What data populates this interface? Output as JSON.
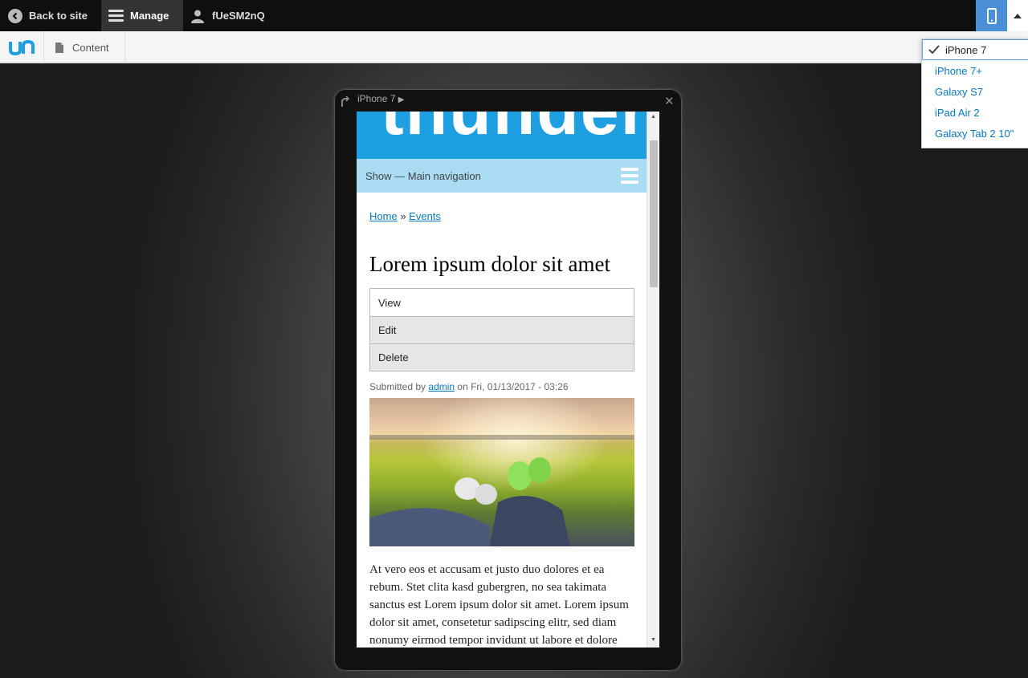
{
  "toolbar": {
    "back_label": "Back to site",
    "manage_label": "Manage",
    "user_label": "fUeSM2nQ"
  },
  "tray": {
    "content_label": "Content"
  },
  "preview": {
    "device_name": "iPhone 7",
    "site": {
      "logo_text": "thunder",
      "nav_label": "Show — Main navigation",
      "breadcrumb": {
        "home": "Home",
        "sep": "»",
        "events": "Events"
      },
      "title": "Lorem ipsum dolor sit amet",
      "tabs": [
        "View",
        "Edit",
        "Delete"
      ],
      "submitted_prefix": "Submitted by",
      "author": "admin",
      "submitted_suffix": "on Fri, 01/13/2017 - 03:26",
      "body": "At vero eos et accusam et justo duo dolores et ea rebum. Stet clita kasd gubergren, no sea takimata sanctus est Lorem ipsum dolor sit amet. Lorem ipsum dolor sit amet, consetetur sadipscing elitr, sed diam nonumy eirmod tempor invidunt ut labore et dolore"
    }
  },
  "device_menu": {
    "options": [
      "iPhone 7",
      "iPhone 7+",
      "Galaxy S7",
      "iPad Air 2",
      "Galaxy Tab 2 10\""
    ],
    "selected": "iPhone 7"
  },
  "colors": {
    "accent": "#4a90d9",
    "link": "#0678be",
    "header_blue": "#1e9fe1",
    "nav_blue": "#a9dcf3"
  }
}
